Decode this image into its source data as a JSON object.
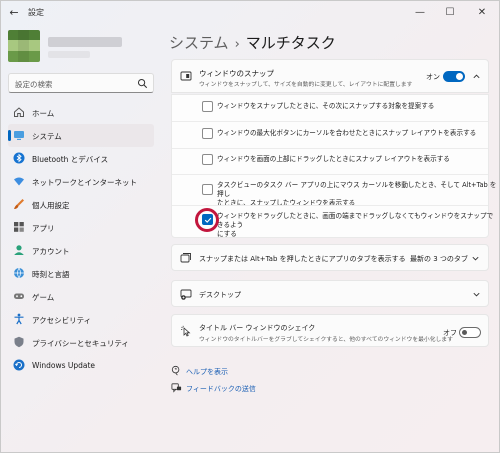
{
  "window": {
    "title": "設定",
    "controls": {
      "minimize": "—",
      "maximize": "☐",
      "close": "✕"
    }
  },
  "search": {
    "placeholder": "設定の検索"
  },
  "nav": {
    "items": [
      {
        "label": "ホーム",
        "icon": "home-icon"
      },
      {
        "label": "システム",
        "icon": "system-icon",
        "active": true
      },
      {
        "label": "Bluetooth とデバイス",
        "icon": "bluetooth-icon"
      },
      {
        "label": "ネットワークとインターネット",
        "icon": "network-icon"
      },
      {
        "label": "個人用設定",
        "icon": "brush-icon"
      },
      {
        "label": "アプリ",
        "icon": "apps-icon"
      },
      {
        "label": "アカウント",
        "icon": "account-icon"
      },
      {
        "label": "時刻と言語",
        "icon": "globe-icon"
      },
      {
        "label": "ゲーム",
        "icon": "game-icon"
      },
      {
        "label": "アクセシビリティ",
        "icon": "accessibility-icon"
      },
      {
        "label": "プライバシーとセキュリティ",
        "icon": "shield-icon"
      },
      {
        "label": "Windows Update",
        "icon": "update-icon"
      }
    ]
  },
  "header": {
    "parent": "システム",
    "separator": "›",
    "title": "マルチタスク"
  },
  "snap": {
    "title": "ウィンドウのスナップ",
    "description": "ウィンドウをスナップして、サイズを自動的に変更して、レイアウトに配置します",
    "state_label": "オン",
    "options": [
      {
        "label": "ウィンドウをスナップしたときに、その次にスナップする対象を提案する",
        "checked": false
      },
      {
        "label": "ウィンドウの最大化ボタンにカーソルを合わせたときにスナップ レイアウトを表示する",
        "checked": false
      },
      {
        "label": "ウィンドウを画面の上部にドラッグしたときにスナップ レイアウトを表示する",
        "checked": false
      },
      {
        "label_line1": "タスクビューのタスク バー アプリの上にマウス カーソルを移動したとき、そして Alt+Tab を押し",
        "label_line2": "たときに、スナップしたウィンドウを表示する",
        "checked": false
      },
      {
        "label_line1": "ウィンドウをドラッグしたときに、画面の端までドラッグしなくてもウィンドウをスナップできるよう",
        "label_line2": "にする",
        "checked": true
      }
    ]
  },
  "alttab": {
    "title": "スナップまたは Alt+Tab を押したときにアプリのタブを表示する",
    "selected": "最新の 3 つのタブ"
  },
  "desktops": {
    "title": "デスクトップ"
  },
  "shake": {
    "title": "タイトル バー ウィンドウのシェイク",
    "description": "ウィンドウのタイトルバーをグラブしてシェイクすると、他のすべてのウィンドウを最小化します",
    "state_label": "オフ"
  },
  "links": {
    "help": "ヘルプを表示",
    "feedback": "フィードバックの送信"
  },
  "colors": {
    "accent": "#0067c0",
    "highlight_ring": "#c2163d"
  }
}
